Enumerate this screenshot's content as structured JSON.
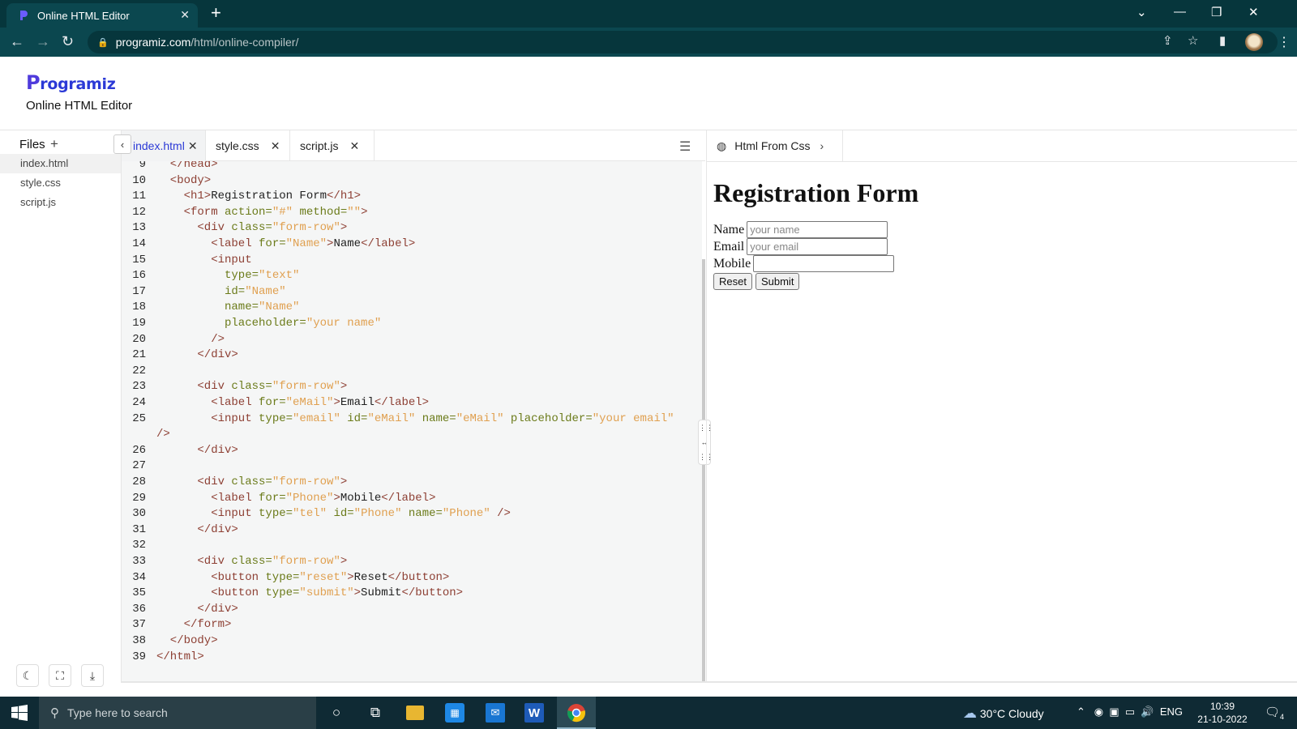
{
  "browser": {
    "tab_title": "Online HTML Editor",
    "tab_close": "✕",
    "new_tab": "+",
    "url_host": "programiz.com",
    "url_path": "/html/online-compiler/"
  },
  "header": {
    "logo_text": "rogramiz",
    "logo_initial": "P",
    "subtitle": "Online HTML Editor"
  },
  "files_panel": {
    "title": "Files",
    "add": "+",
    "items": [
      "index.html",
      "style.css",
      "script.js"
    ]
  },
  "editor": {
    "tabs": [
      "index.html",
      "style.css",
      "script.js"
    ],
    "active_tab": "index.html",
    "lines": [
      {
        "n": "9",
        "indent": 1,
        "html": "<span class='t'>&lt;/head&gt;</span>"
      },
      {
        "n": "10",
        "indent": 1,
        "html": "<span class='t'>&lt;body&gt;</span>"
      },
      {
        "n": "11",
        "indent": 2,
        "html": "<span class='t'>&lt;h1&gt;</span>Registration Form<span class='t'>&lt;/h1&gt;</span>"
      },
      {
        "n": "12",
        "indent": 2,
        "html": "<span class='t'>&lt;form</span> <span class='a'>action=</span><span class='s'>\"#\"</span> <span class='a'>method=</span><span class='s'>\"\"</span><span class='t'>&gt;</span>"
      },
      {
        "n": "13",
        "indent": 3,
        "html": "<span class='t'>&lt;div</span> <span class='a'>class=</span><span class='s'>\"form-row\"</span><span class='t'>&gt;</span>"
      },
      {
        "n": "14",
        "indent": 4,
        "html": "<span class='t'>&lt;label</span> <span class='a'>for=</span><span class='s'>\"Name\"</span><span class='t'>&gt;</span>Name<span class='t'>&lt;/label&gt;</span>"
      },
      {
        "n": "15",
        "indent": 4,
        "html": "<span class='t'>&lt;input</span>"
      },
      {
        "n": "16",
        "indent": 5,
        "html": "<span class='a'>type=</span><span class='s'>\"text\"</span>"
      },
      {
        "n": "17",
        "indent": 5,
        "html": "<span class='a'>id=</span><span class='s'>\"Name\"</span>"
      },
      {
        "n": "18",
        "indent": 5,
        "html": "<span class='a'>name=</span><span class='s'>\"Name\"</span>"
      },
      {
        "n": "19",
        "indent": 5,
        "html": "<span class='a'>placeholder=</span><span class='s'>\"your name\"</span>"
      },
      {
        "n": "20",
        "indent": 4,
        "html": "<span class='t'>/&gt;</span>"
      },
      {
        "n": "21",
        "indent": 3,
        "html": "<span class='t'>&lt;/div&gt;</span>"
      },
      {
        "n": "22",
        "indent": 0,
        "html": ""
      },
      {
        "n": "23",
        "indent": 3,
        "html": "<span class='t'>&lt;div</span> <span class='a'>class=</span><span class='s'>\"form-row\"</span><span class='t'>&gt;</span>"
      },
      {
        "n": "24",
        "indent": 4,
        "html": "<span class='t'>&lt;label</span> <span class='a'>for=</span><span class='s'>\"eMail\"</span><span class='t'>&gt;</span>Email<span class='t'>&lt;/label&gt;</span>"
      },
      {
        "n": "25",
        "indent": 4,
        "html": "<span class='t'>&lt;input</span> <span class='a'>type=</span><span class='s'>\"email\"</span> <span class='a'>id=</span><span class='s'>\"eMail\"</span> <span class='a'>name=</span><span class='s'>\"eMail\"</span> <span class='a'>placeholder=</span><span class='s'>\"your email\"</span>"
      },
      {
        "n": "",
        "indent": 0,
        "html": "<span class='t'>/&gt;</span>"
      },
      {
        "n": "26",
        "indent": 3,
        "html": "<span class='t'>&lt;/div&gt;</span>"
      },
      {
        "n": "27",
        "indent": 0,
        "html": ""
      },
      {
        "n": "28",
        "indent": 3,
        "html": "<span class='t'>&lt;div</span> <span class='a'>class=</span><span class='s'>\"form-row\"</span><span class='t'>&gt;</span>"
      },
      {
        "n": "29",
        "indent": 4,
        "html": "<span class='t'>&lt;label</span> <span class='a'>for=</span><span class='s'>\"Phone\"</span><span class='t'>&gt;</span>Mobile<span class='t'>&lt;/label&gt;</span>"
      },
      {
        "n": "30",
        "indent": 4,
        "html": "<span class='t'>&lt;input</span> <span class='a'>type=</span><span class='s'>\"tel\"</span> <span class='a'>id=</span><span class='s'>\"Phone\"</span> <span class='a'>name=</span><span class='s'>\"Phone\"</span> <span class='t'>/&gt;</span>"
      },
      {
        "n": "31",
        "indent": 3,
        "html": "<span class='t'>&lt;/div&gt;</span>"
      },
      {
        "n": "32",
        "indent": 0,
        "html": ""
      },
      {
        "n": "33",
        "indent": 3,
        "html": "<span class='t'>&lt;div</span> <span class='a'>class=</span><span class='s'>\"form-row\"</span><span class='t'>&gt;</span>"
      },
      {
        "n": "34",
        "indent": 4,
        "html": "<span class='t'>&lt;button</span> <span class='a'>type=</span><span class='s'>\"reset\"</span><span class='t'>&gt;</span>Reset<span class='t'>&lt;/button&gt;</span>"
      },
      {
        "n": "35",
        "indent": 4,
        "html": "<span class='t'>&lt;button</span> <span class='a'>type=</span><span class='s'>\"submit\"</span><span class='t'>&gt;</span>Submit<span class='t'>&lt;/button&gt;</span>"
      },
      {
        "n": "36",
        "indent": 3,
        "html": "<span class='t'>&lt;/div&gt;</span>"
      },
      {
        "n": "37",
        "indent": 2,
        "html": "<span class='t'>&lt;/form&gt;</span>"
      },
      {
        "n": "38",
        "indent": 1,
        "html": "<span class='t'>&lt;/body&gt;</span>"
      },
      {
        "n": "39",
        "indent": 0,
        "html": "<span class='t'>&lt;/html&gt;</span>"
      }
    ]
  },
  "preview": {
    "tab_title": "Html From Css",
    "heading": "Registration Form",
    "name_label": "Name",
    "name_placeholder": "your name",
    "email_label": "Email",
    "email_placeholder": "your email",
    "mobile_label": "Mobile",
    "reset_label": "Reset",
    "submit_label": "Submit"
  },
  "taskbar": {
    "search_placeholder": "Type here to search",
    "weather": "30°C  Cloudy",
    "language": "ENG",
    "time": "10:39",
    "date": "21-10-2022",
    "notifications": "4"
  },
  "colors": {
    "chrome_dark": "#06363c",
    "chrome_bar": "#0b474f",
    "brand": "#2b39d6",
    "tag": "#8d3f33",
    "attr": "#6b7b1a",
    "string": "#e0a050"
  }
}
